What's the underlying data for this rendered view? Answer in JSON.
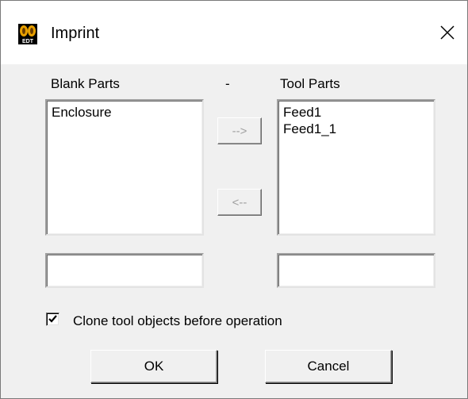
{
  "window": {
    "title": "Imprint",
    "icon": "edt-app-icon",
    "close_icon": "close-icon"
  },
  "labels": {
    "blank_parts": "Blank Parts",
    "separator": "-",
    "tool_parts": "Tool Parts"
  },
  "blank_parts": {
    "items": [
      "Enclosure"
    ],
    "filter_value": ""
  },
  "tool_parts": {
    "items": [
      "Feed1",
      "Feed1_1"
    ],
    "filter_value": ""
  },
  "buttons": {
    "move_right": "-->",
    "move_left": "<--",
    "ok": "OK",
    "cancel": "Cancel"
  },
  "options": {
    "clone_label": "Clone tool objects before operation",
    "clone_checked": true
  },
  "colors": {
    "dialog_bg": "#f0f0f0",
    "titlebar_bg": "#ffffff",
    "disabled_text": "#a0a0a0"
  }
}
